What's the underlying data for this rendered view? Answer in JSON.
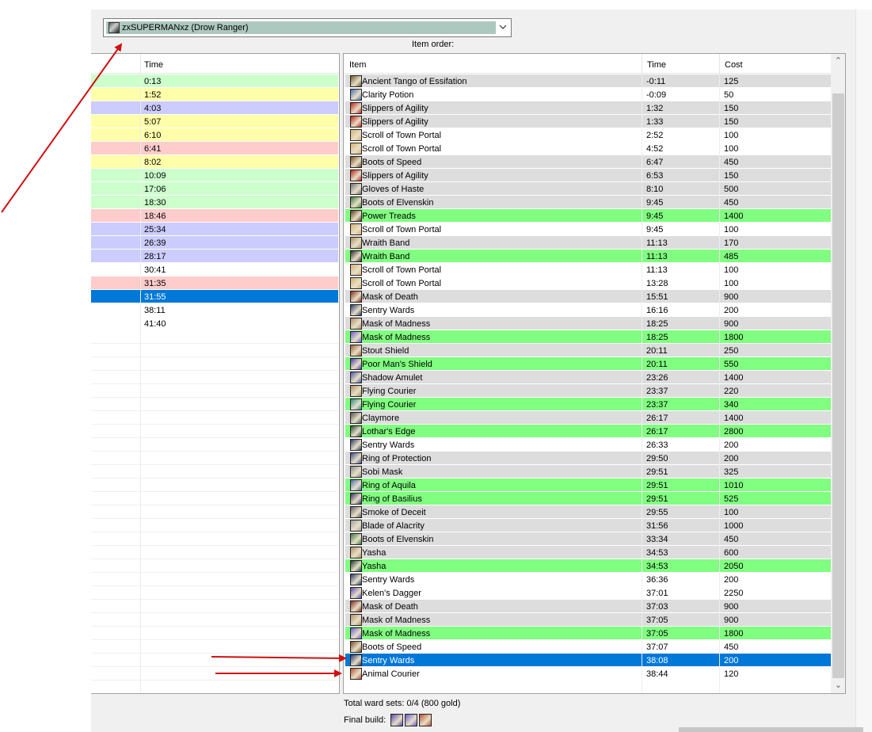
{
  "player_select": {
    "value": "zxSUPERMANxz (Drow Ranger)"
  },
  "item_order_label": "Item order:",
  "left_table": {
    "header_time": "Time",
    "rows": [
      {
        "time": "0:13",
        "color": "#ccffcc"
      },
      {
        "time": "1:52",
        "color": "#ffffaa"
      },
      {
        "time": "4:03",
        "color": "#ccccff"
      },
      {
        "time": "5:07",
        "color": "#ffffaa"
      },
      {
        "time": "6:10",
        "color": "#ffffaa"
      },
      {
        "time": "6:41",
        "color": "#ffcccc"
      },
      {
        "time": "8:02",
        "color": "#ffffaa"
      },
      {
        "time": "10:09",
        "color": "#ccffcc"
      },
      {
        "time": "17:06",
        "color": "#ccffcc"
      },
      {
        "time": "18:30",
        "color": "#ccffcc"
      },
      {
        "time": "18:46",
        "color": "#ffcccc"
      },
      {
        "time": "25:34",
        "color": "#ccccff"
      },
      {
        "time": "26:39",
        "color": "#ccccff"
      },
      {
        "time": "28:17",
        "color": "#ccccff"
      },
      {
        "time": "30:41",
        "color": "#ffffff"
      },
      {
        "time": "31:35",
        "color": "#ffcccc"
      },
      {
        "time": "31:55",
        "color": "#0078d7",
        "selected": true
      },
      {
        "time": "38:11",
        "color": "#ffffff"
      },
      {
        "time": "41:40",
        "color": "#ffffff"
      }
    ]
  },
  "right_table": {
    "headers": {
      "item": "Item",
      "time": "Time",
      "cost": "Cost"
    },
    "rows": [
      {
        "item": "Ancient Tango of Essifation",
        "time": "-0:11",
        "cost": "125",
        "bg": "#dddddd",
        "icon": "#6b5a2a"
      },
      {
        "item": "Clarity Potion",
        "time": "-0:09",
        "cost": "50",
        "bg": "#ffffff",
        "icon": "#4a6fb0"
      },
      {
        "item": "Slippers of Agility",
        "time": "1:32",
        "cost": "150",
        "bg": "#dddddd",
        "icon": "#c0201a"
      },
      {
        "item": "Slippers of Agility",
        "time": "1:33",
        "cost": "150",
        "bg": "#dddddd",
        "icon": "#c0201a"
      },
      {
        "item": "Scroll of Town Portal",
        "time": "2:52",
        "cost": "100",
        "bg": "#ffffff",
        "icon": "#d8b070"
      },
      {
        "item": "Scroll of Town Portal",
        "time": "4:52",
        "cost": "100",
        "bg": "#ffffff",
        "icon": "#d8b070"
      },
      {
        "item": "Boots of Speed",
        "time": "6:47",
        "cost": "450",
        "bg": "#dddddd",
        "icon": "#7a4a22"
      },
      {
        "item": "Slippers of Agility",
        "time": "6:53",
        "cost": "150",
        "bg": "#dddddd",
        "icon": "#c0201a"
      },
      {
        "item": "Gloves of Haste",
        "time": "8:10",
        "cost": "500",
        "bg": "#dddddd",
        "icon": "#707070"
      },
      {
        "item": "Boots of Elvenskin",
        "time": "9:45",
        "cost": "450",
        "bg": "#dddddd",
        "icon": "#3a7a3a"
      },
      {
        "item": "Power Treads",
        "time": "9:45",
        "cost": "1400",
        "bg": "#80ff80",
        "icon": "#5a3a1a"
      },
      {
        "item": "Scroll of Town Portal",
        "time": "9:45",
        "cost": "100",
        "bg": "#ffffff",
        "icon": "#d8b070"
      },
      {
        "item": "Wraith Band",
        "time": "11:13",
        "cost": "170",
        "bg": "#dddddd",
        "icon": "#b09060"
      },
      {
        "item": "Wraith Band",
        "time": "11:13",
        "cost": "485",
        "bg": "#80ff80",
        "icon": "#302a2a"
      },
      {
        "item": "Scroll of Town Portal",
        "time": "11:13",
        "cost": "100",
        "bg": "#ffffff",
        "icon": "#d8b070"
      },
      {
        "item": "Scroll of Town Portal",
        "time": "13:28",
        "cost": "100",
        "bg": "#ffffff",
        "icon": "#d8b070"
      },
      {
        "item": "Mask of Death",
        "time": "15:51",
        "cost": "900",
        "bg": "#dddddd",
        "icon": "#8a2a1a"
      },
      {
        "item": "Sentry Wards",
        "time": "16:16",
        "cost": "200",
        "bg": "#ffffff",
        "icon": "#2a3a6a"
      },
      {
        "item": "Mask of Madness",
        "time": "18:25",
        "cost": "900",
        "bg": "#dddddd",
        "icon": "#b09060"
      },
      {
        "item": "Mask of Madness",
        "time": "18:25",
        "cost": "1800",
        "bg": "#80ff80",
        "icon": "#6a5ad0"
      },
      {
        "item": "Stout Shield",
        "time": "20:11",
        "cost": "250",
        "bg": "#dddddd",
        "icon": "#a06030"
      },
      {
        "item": "Poor Man's Shield",
        "time": "20:11",
        "cost": "550",
        "bg": "#80ff80",
        "icon": "#4a3ab0"
      },
      {
        "item": "Shadow Amulet",
        "time": "23:26",
        "cost": "1400",
        "bg": "#dddddd",
        "icon": "#4a5aa0"
      },
      {
        "item": "Flying Courier",
        "time": "23:37",
        "cost": "220",
        "bg": "#dddddd",
        "icon": "#b09060"
      },
      {
        "item": "Flying Courier",
        "time": "23:37",
        "cost": "340",
        "bg": "#80ff80",
        "icon": "#2a8a8a"
      },
      {
        "item": "Claymore",
        "time": "26:17",
        "cost": "1400",
        "bg": "#dddddd",
        "icon": "#505050"
      },
      {
        "item": "Lothar's Edge",
        "time": "26:17",
        "cost": "2800",
        "bg": "#80ff80",
        "icon": "#2a4a3a"
      },
      {
        "item": "Sentry Wards",
        "time": "26:33",
        "cost": "200",
        "bg": "#ffffff",
        "icon": "#2a3a6a"
      },
      {
        "item": "Ring of Protection",
        "time": "29:50",
        "cost": "200",
        "bg": "#dddddd",
        "icon": "#3a4a8a"
      },
      {
        "item": "Sobi Mask",
        "time": "29:51",
        "cost": "325",
        "bg": "#dddddd",
        "icon": "#8a8a8a"
      },
      {
        "item": "Ring of Aquila",
        "time": "29:51",
        "cost": "1010",
        "bg": "#80ff80",
        "icon": "#4a6ab0"
      },
      {
        "item": "Ring of Basilius",
        "time": "29:51",
        "cost": "525",
        "bg": "#80ff80",
        "icon": "#3a2a6a"
      },
      {
        "item": "Smoke of Deceit",
        "time": "29:55",
        "cost": "100",
        "bg": "#dddddd",
        "icon": "#606060"
      },
      {
        "item": "Blade of Alacrity",
        "time": "31:56",
        "cost": "1000",
        "bg": "#dddddd",
        "icon": "#a0a0a0"
      },
      {
        "item": "Boots of Elvenskin",
        "time": "33:34",
        "cost": "450",
        "bg": "#dddddd",
        "icon": "#3a7a3a"
      },
      {
        "item": "Yasha",
        "time": "34:53",
        "cost": "600",
        "bg": "#dddddd",
        "icon": "#b09060"
      },
      {
        "item": "Yasha",
        "time": "34:53",
        "cost": "2050",
        "bg": "#80ff80",
        "icon": "#1a3a2a"
      },
      {
        "item": "Sentry Wards",
        "time": "36:36",
        "cost": "200",
        "bg": "#ffffff",
        "icon": "#2a3a6a"
      },
      {
        "item": "Kelen's Dagger",
        "time": "37:01",
        "cost": "2250",
        "bg": "#ffffff",
        "icon": "#5a4ab0"
      },
      {
        "item": "Mask of Death",
        "time": "37:03",
        "cost": "900",
        "bg": "#dddddd",
        "icon": "#8a2a1a"
      },
      {
        "item": "Mask of Madness",
        "time": "37:05",
        "cost": "900",
        "bg": "#dddddd",
        "icon": "#b09060"
      },
      {
        "item": "Mask of Madness",
        "time": "37:05",
        "cost": "1800",
        "bg": "#80ff80",
        "icon": "#6a5ad0"
      },
      {
        "item": "Boots of Speed",
        "time": "37:07",
        "cost": "450",
        "bg": "#ffffff",
        "icon": "#7a4a22"
      },
      {
        "item": "Sentry Wards",
        "time": "38:08",
        "cost": "200",
        "bg": "#0078d7",
        "icon": "#2a3a6a",
        "selected": true
      },
      {
        "item": "Animal Courier",
        "time": "38:44",
        "cost": "120",
        "bg": "#ffffff",
        "icon": "#c05030"
      }
    ]
  },
  "footer": {
    "ward_sets": "Total ward sets: 0/4 (800 gold)",
    "final_build_label": "Final build:",
    "final_build_icons": [
      {
        "name": "kelens-dagger-icon",
        "color": "#5a4ab0"
      },
      {
        "name": "mask-of-madness-icon",
        "color": "#6a5ad0"
      },
      {
        "name": "animal-courier-icon",
        "color": "#c05030"
      }
    ]
  },
  "colors": {
    "selection": "#0078d7",
    "upgrade_green": "#80ff80",
    "annotation_arrow": "#d01010"
  }
}
